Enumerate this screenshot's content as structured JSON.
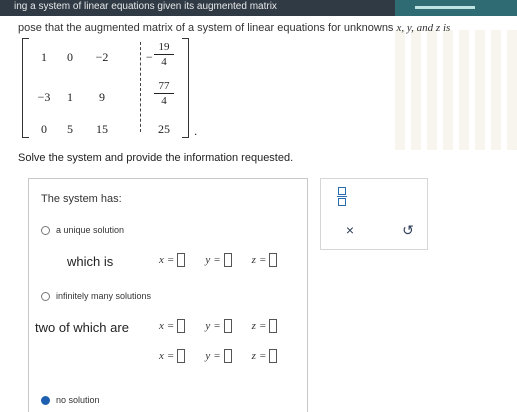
{
  "header": {
    "title": "ing a system of linear equations given its augmented matrix"
  },
  "prompt": {
    "text_before": "pose that the augmented matrix of a system of linear equations for unknowns ",
    "vars": "x, y, and z is"
  },
  "matrix": {
    "rows": [
      [
        "1",
        "0",
        "−2"
      ],
      [
        "−3",
        "1",
        "9"
      ],
      [
        "0",
        "5",
        "15"
      ]
    ],
    "augmented": [
      {
        "sign": "−",
        "num": "19",
        "den": "4"
      },
      {
        "sign": "",
        "num": "77",
        "den": "4"
      },
      {
        "sign": "",
        "value": "25"
      }
    ],
    "period": "."
  },
  "instruction": "Solve the system and provide the information requested.",
  "answer": {
    "system_has": "The system has:",
    "options": [
      {
        "label": "a unique solution",
        "selected": false
      },
      {
        "label": "infinitely many solutions",
        "selected": false
      },
      {
        "label": "no solution",
        "selected": true
      }
    ],
    "which_is": "which is",
    "two_of_which_are": "two of which are",
    "vars": {
      "x": "x",
      "y": "y",
      "z": "z",
      "eq": "="
    }
  },
  "tools": {
    "fraction": "fraction-icon",
    "clear": "×",
    "undo": "↺"
  }
}
